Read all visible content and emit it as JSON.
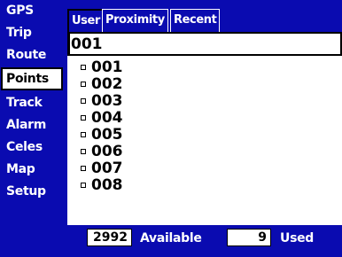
{
  "sidebar": {
    "items": [
      {
        "label": "GPS"
      },
      {
        "label": "Trip"
      },
      {
        "label": "Route"
      },
      {
        "label": "Points"
      },
      {
        "label": "Track"
      },
      {
        "label": "Alarm"
      },
      {
        "label": "Celes"
      },
      {
        "label": "Map"
      },
      {
        "label": "Setup"
      }
    ],
    "selected": "Points"
  },
  "tabs": [
    {
      "label": "User"
    },
    {
      "label": "Proximity"
    },
    {
      "label": "Recent"
    }
  ],
  "search": {
    "value": "001"
  },
  "points": [
    "001",
    "002",
    "003",
    "004",
    "005",
    "006",
    "007",
    "008"
  ],
  "footer": {
    "available_count": "2992",
    "available_label": "Available",
    "used_count": "9",
    "used_label": "Used"
  },
  "colors": {
    "background": "#0a0bb0",
    "panel": "#ffffff",
    "text_light": "#ffffff",
    "text_dark": "#000000"
  }
}
